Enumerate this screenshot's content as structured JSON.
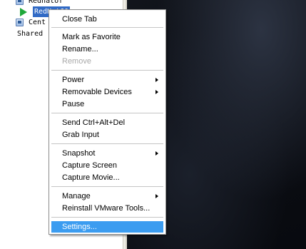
{
  "library": {
    "items": [
      {
        "label": "Redhatof",
        "icon": "vm-icon",
        "selected": false
      },
      {
        "label": "RedHat60",
        "icon": "play-icon",
        "selected": true
      },
      {
        "label": "Cent",
        "icon": "vm-icon",
        "selected": false
      },
      {
        "label": "Shared",
        "icon": "",
        "selected": false
      }
    ]
  },
  "context_menu": {
    "close_tab": "Close Tab",
    "mark_favorite": "Mark as Favorite",
    "rename": "Rename...",
    "remove": "Remove",
    "power": "Power",
    "removable_devices": "Removable Devices",
    "pause": "Pause",
    "send_ctrl_alt_del": "Send Ctrl+Alt+Del",
    "grab_input": "Grab Input",
    "snapshot": "Snapshot",
    "capture_screen": "Capture Screen",
    "capture_movie": "Capture Movie...",
    "manage": "Manage",
    "reinstall_tools": "Reinstall VMware Tools...",
    "settings": "Settings..."
  },
  "colors": {
    "highlight": "#3b9cf0",
    "tree_selection": "#316ac5",
    "disabled_text": "#a8a8a8"
  }
}
